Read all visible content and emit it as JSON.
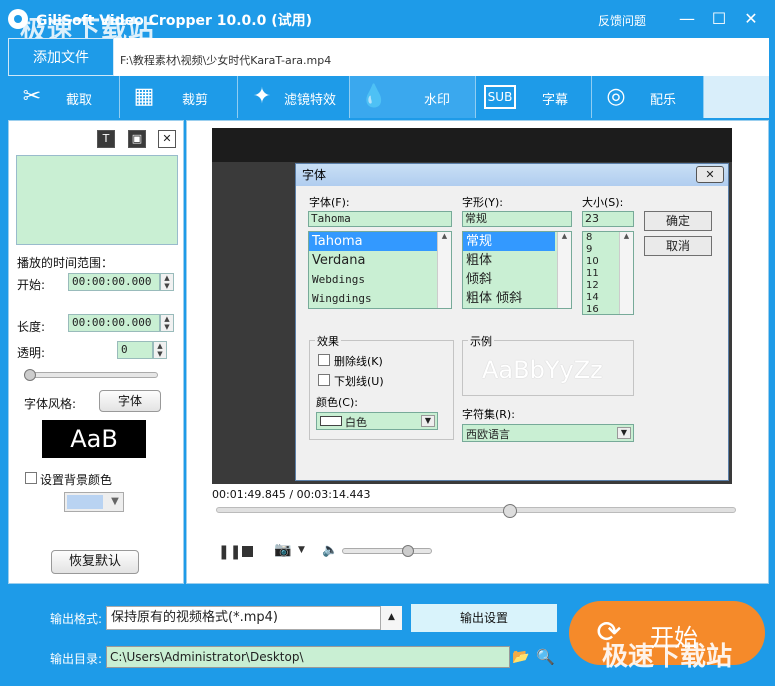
{
  "app": {
    "title": "GiliSoft Video Cropper 10.0.0 (试用)",
    "feedback": "反馈问题",
    "watermark": "极速下载站"
  },
  "file": {
    "add_label": "添加文件",
    "path": "F:\\教程素材\\视频\\少女时代KaraT-ara.mp4"
  },
  "tabs": [
    {
      "label": "截取",
      "icon": "scissors-icon"
    },
    {
      "label": "裁剪",
      "icon": "crop-icon"
    },
    {
      "label": "滤镜特效",
      "icon": "stars-icon"
    },
    {
      "label": "水印",
      "icon": "drop-icon"
    },
    {
      "label": "字幕",
      "icon": "subtitle-icon"
    },
    {
      "label": "配乐",
      "icon": "audio-icon"
    }
  ],
  "left": {
    "time_range_label": "播放的时间范围：",
    "start_label": "开始:",
    "start_value": "00:00:00.000",
    "length_label": "长度:",
    "length_value": "00:00:00.000",
    "opacity_label": "透明:",
    "opacity_value": "0",
    "font_style_label": "字体风格:",
    "font_button": "字体",
    "font_sample": "AaB",
    "bg_color_label": "设置背景颜色",
    "restore_button": "恢复默认",
    "bg_color": "#b9d3f2"
  },
  "player": {
    "time": "00:01:49.845 / 00:03:14.443",
    "progress": 0.5656
  },
  "font_dialog": {
    "title": "字体",
    "font_label": "字体(F):",
    "font_value": "Tahoma",
    "fonts": [
      "Tahoma",
      "Verdana",
      "Webdings",
      "Wingdings"
    ],
    "style_label": "字形(Y):",
    "style_value": "常规",
    "styles": [
      "常规",
      "粗体",
      "倾斜",
      "粗体 倾斜"
    ],
    "size_label": "大小(S):",
    "size_value": "23",
    "sizes": [
      "8",
      "9",
      "10",
      "11",
      "12",
      "14",
      "16"
    ],
    "ok": "确定",
    "cancel": "取消",
    "effects_label": "效果",
    "strikeout": "删除线(K)",
    "underline": "下划线(U)",
    "color_label": "颜色(C):",
    "color_value": "白色",
    "sample_label": "示例",
    "sample_text": "AaBbYyZz",
    "charset_label": "字符集(R):",
    "charset_value": "西欧语言"
  },
  "bottom": {
    "format_label": "输出格式:",
    "format_value": "保持原有的视频格式(*.mp4)",
    "settings_button": "输出设置",
    "dir_label": "输出目录:",
    "dir_value": "C:\\Users\\Administrator\\Desktop\\",
    "start_label": "开始"
  }
}
